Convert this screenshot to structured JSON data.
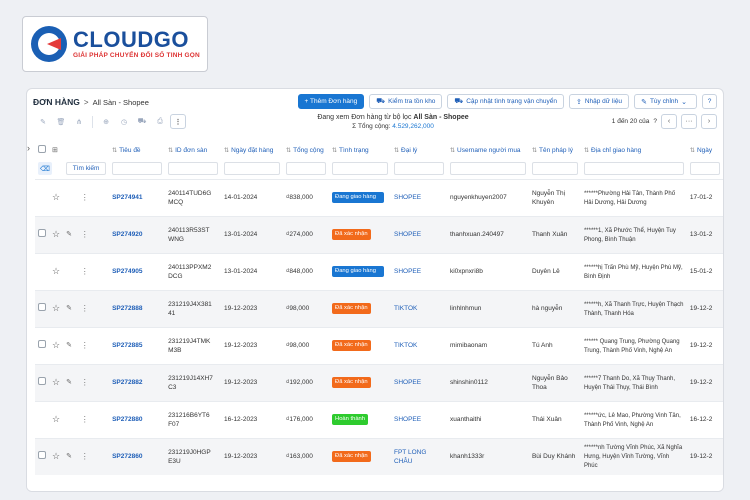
{
  "brand": {
    "name": "CLOUDGO",
    "tagline": "GIẢI PHÁP CHUYỂN ĐỔI SỐ TINH GỌN"
  },
  "breadcrumb": {
    "title": "ĐƠN HÀNG",
    "separator": ">",
    "sub": "All Sàn - Shopee"
  },
  "top_buttons": {
    "add": "+ Thêm Đơn hàng",
    "stock": "Kiểm tra tồn kho",
    "shipping": "Cập nhật tình trạng vận chuyển",
    "import": "Nhập dữ liệu",
    "custom": "Tùy chỉnh",
    "help": "?"
  },
  "filter_info": {
    "prefix": "Đang xem Đơn hàng từ bộ lọc ",
    "filter": "All Sàn - Shopee",
    "total_label": "Σ Tổng cộng: ",
    "total_value": "4.529,262,000"
  },
  "pager": {
    "text": "1 đến 20 của",
    "question": "?",
    "prev": "‹",
    "more": "···",
    "next": "›"
  },
  "columns": {
    "code": "Tiêu đề",
    "id": "ID đơn sàn",
    "date": "Ngày đặt hàng",
    "total": "Tổng cộng",
    "status": "Tình trạng",
    "agent": "Đại lý",
    "buyer": "Username người mua",
    "legal": "Tên pháp lý",
    "address": "Địa chỉ giao hàng",
    "date2": "Ngày"
  },
  "search_label": "Tìm kiếm",
  "colors": {
    "accent": "#1976d2",
    "shipping": "#1976d2",
    "confirmed": "#f26a1b",
    "done": "#2ecb2e"
  },
  "rows": [
    {
      "code": "SP274941",
      "id": "240114TUD6G MCQ",
      "date": "14-01-2024",
      "total": "₫838,000",
      "status": "Đang giao hàng",
      "status_type": "shipping",
      "agent": "SHOPEE",
      "buyer": "nguyenkhuyen2007",
      "legal": "Nguyễn Thị Khuyên",
      "address": "******Phường Hải Tân, Thành Phố Hải Dương, Hải Dương",
      "date2": "17-01-2",
      "has_checkbox": false
    },
    {
      "code": "SP274920",
      "id": "240113R53ST WNG",
      "date": "13-01-2024",
      "total": "₫274,000",
      "status": "Đã xác nhận",
      "status_type": "confirmed",
      "agent": "SHOPEE",
      "buyer": "thanhxuan.240497",
      "legal": "Thanh Xuân",
      "address": "******1, Xã Phước Thể, Huyện Tuy Phong, Bình Thuận",
      "date2": "13-01-2",
      "has_checkbox": true
    },
    {
      "code": "SP274905",
      "id": "240113PPXM2 DCG",
      "date": "13-01-2024",
      "total": "₫848,000",
      "status": "Đang giao hàng",
      "status_type": "shipping",
      "agent": "SHOPEE",
      "buyer": "ki0xpnxri8b",
      "legal": "Duyên Lê",
      "address": "******hị Trấn Phù Mỹ, Huyện Phù Mỹ, Bình Định",
      "date2": "15-01-2",
      "has_checkbox": false
    },
    {
      "code": "SP272888",
      "id": "231219J4X381 41",
      "date": "19-12-2023",
      "total": "₫98,000",
      "status": "Đã xác nhận",
      "status_type": "confirmed",
      "agent": "TIKTOK",
      "buyer": "linhlnhmun",
      "legal": "hà nguyễn",
      "address": "******h, Xã Thanh Trực, Huyện Thạch Thành, Thanh Hóa",
      "date2": "19-12-2",
      "has_checkbox": true
    },
    {
      "code": "SP272885",
      "id": "231219J4TMK M3B",
      "date": "19-12-2023",
      "total": "₫98,000",
      "status": "Đã xác nhận",
      "status_type": "confirmed",
      "agent": "TIKTOK",
      "buyer": "mimibaonam",
      "legal": "Tú Anh",
      "address": "****** Quang Trung, Phường Quang Trung, Thành Phố Vinh, Nghệ An",
      "date2": "19-12-2",
      "has_checkbox": true
    },
    {
      "code": "SP272882",
      "id": "231219J14XH7 C3",
      "date": "19-12-2023",
      "total": "₫192,000",
      "status": "Đã xác nhận",
      "status_type": "confirmed",
      "agent": "SHOPEE",
      "buyer": "shinshin0112",
      "legal": "Nguyễn Bảo Thoa",
      "address": "******7 Thanh Do, Xã Thụy Thanh, Huyện Thái Thụy, Thái Bình",
      "date2": "19-12-2",
      "has_checkbox": true
    },
    {
      "code": "SP272880",
      "id": "231216B6YT6 F07",
      "date": "16-12-2023",
      "total": "₫176,000",
      "status": "Hoàn thành",
      "status_type": "done",
      "agent": "SHOPEE",
      "buyer": "xuanthaithi",
      "legal": "Thái Xuân",
      "address": "******ức, Lê Mao, Phường Vinh Tân, Thành Phố Vinh, Nghệ An",
      "date2": "16-12-2",
      "has_checkbox": false
    },
    {
      "code": "SP272860",
      "id": "231219J0HGP E3U",
      "date": "19-12-2023",
      "total": "₫163,000",
      "status": "Đã xác nhận",
      "status_type": "confirmed",
      "agent": "FPT LONG CHÂU",
      "buyer": "khanh1333r",
      "legal": "Bùi Duy Khánh",
      "address": "******nh Tường Vĩnh Phúc, Xã Nghĩa Hưng, Huyện Vĩnh Tường, Vĩnh Phúc",
      "date2": "19-12-2",
      "has_checkbox": true
    }
  ]
}
